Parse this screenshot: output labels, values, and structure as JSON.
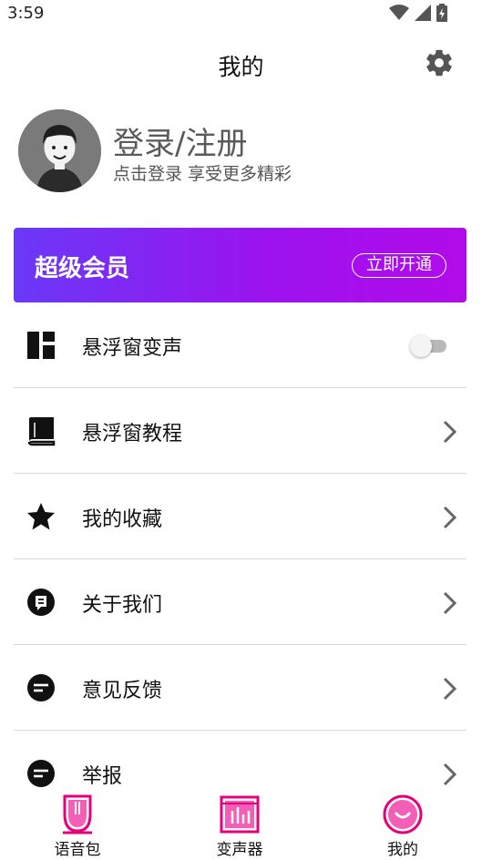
{
  "status_bar": {
    "time": "3:59"
  },
  "header": {
    "title": "我的"
  },
  "profile": {
    "title": "登录/注册",
    "subtitle": "点击登录 享受更多精彩"
  },
  "vip": {
    "title": "超级会员",
    "button_label": "立即开通",
    "gradient_start": "#6a39f7",
    "gradient_end": "#b20bea"
  },
  "menu": [
    {
      "label": "悬浮窗变声",
      "icon": "dashboard-icon",
      "control": "toggle",
      "toggle_on": false
    },
    {
      "label": "悬浮窗教程",
      "icon": "book-icon",
      "control": "chevron"
    },
    {
      "label": "我的收藏",
      "icon": "star-icon",
      "control": "chevron"
    },
    {
      "label": "关于我们",
      "icon": "about-icon",
      "control": "chevron"
    },
    {
      "label": "意见反馈",
      "icon": "feedback-icon",
      "control": "chevron"
    },
    {
      "label": "举报",
      "icon": "report-icon",
      "control": "chevron"
    }
  ],
  "tabs": [
    {
      "label": "语音包",
      "icon": "voice-pack-icon"
    },
    {
      "label": "变声器",
      "icon": "voice-changer-icon"
    },
    {
      "label": "我的",
      "icon": "profile-face-icon",
      "active": true
    }
  ],
  "colors": {
    "accent": "#e6007e",
    "text": "#111111",
    "divider": "#d9d9d9"
  }
}
